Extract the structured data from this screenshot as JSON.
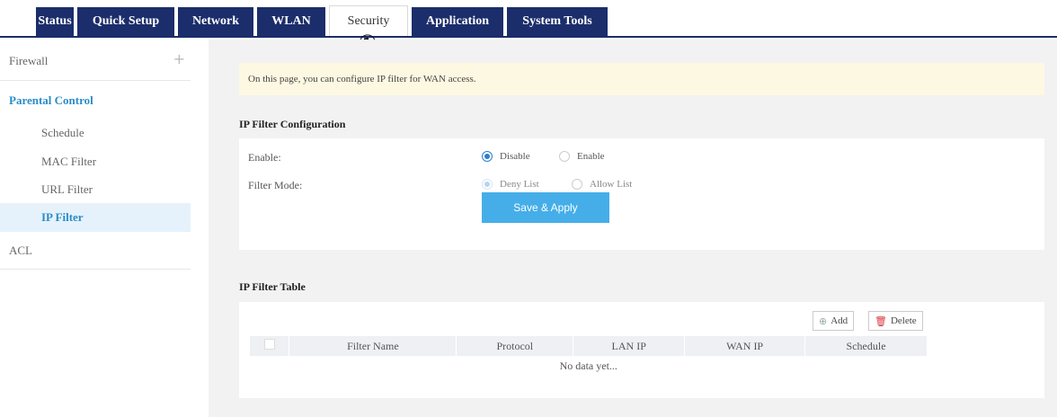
{
  "tabs": [
    {
      "label": "Status",
      "active": false
    },
    {
      "label": "Quick Setup",
      "active": false
    },
    {
      "label": "Network",
      "active": false
    },
    {
      "label": "WLAN",
      "active": false
    },
    {
      "label": "Security",
      "active": true
    },
    {
      "label": "Application",
      "active": false
    },
    {
      "label": "System Tools",
      "active": false
    }
  ],
  "markers": {
    "one": "①",
    "two": "②",
    "three": "③"
  },
  "sidebar": {
    "firewall": "Firewall",
    "firewall_expand": "+",
    "parental_control": "Parental Control",
    "items": [
      "Schedule",
      "MAC Filter",
      "URL Filter",
      "IP Filter"
    ],
    "selected_item": "IP Filter",
    "acl": "ACL"
  },
  "notice": "On this page, you can configure IP filter for WAN access.",
  "config": {
    "title": "IP Filter Configuration",
    "enable_label": "Enable:",
    "enable_options": [
      "Disable",
      "Enable"
    ],
    "enable_selected": "Disable",
    "mode_label": "Filter Mode:",
    "mode_options": [
      "Deny List",
      "Allow List"
    ],
    "mode_selected": "Deny List",
    "save_label": "Save & Apply"
  },
  "table": {
    "title": "IP Filter Table",
    "add_label": "Add",
    "delete_label": "Delete",
    "columns": [
      "Filter Name",
      "Protocol",
      "LAN IP",
      "WAN IP",
      "Schedule"
    ],
    "empty_text": "No data yet..."
  },
  "colors": {
    "tab_bg": "#1b2d6b",
    "accent": "#2a8cc8",
    "button": "#45aee8",
    "notice_bg": "#fdf8e2",
    "delete_icon": "#d9363e"
  },
  "icons": {
    "add": "plus-circle-icon",
    "delete": "trash-icon"
  }
}
